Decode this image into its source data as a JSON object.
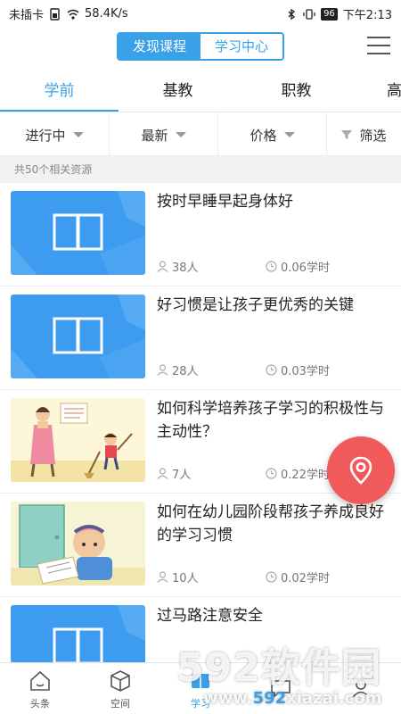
{
  "status_bar": {
    "carrier": "未插卡",
    "speed": "58.4K/s",
    "battery": "96",
    "time": "下午2:13"
  },
  "header": {
    "tabs": [
      {
        "label": "发现课程",
        "active": true
      },
      {
        "label": "学习中心",
        "active": false
      }
    ],
    "menu_icon": "hamburger-menu-icon"
  },
  "category_tabs": [
    {
      "label": "学前",
      "active": true
    },
    {
      "label": "基教",
      "active": false
    },
    {
      "label": "职教",
      "active": false
    },
    {
      "label": "高",
      "active": false
    }
  ],
  "filters": [
    {
      "label": "进行中",
      "icon": "caret-down-icon"
    },
    {
      "label": "最新",
      "icon": "caret-down-icon"
    },
    {
      "label": "价格",
      "icon": "caret-down-icon"
    },
    {
      "label": "筛选",
      "icon": "funnel-icon"
    }
  ],
  "result_count": "共50个相关资源",
  "courses": [
    {
      "title": "按时早睡早起身体好",
      "learners": "38人",
      "hours": "0.06学时",
      "thumb": "book-icon"
    },
    {
      "title": "好习惯是让孩子更优秀的关键",
      "learners": "28人",
      "hours": "0.03学时",
      "thumb": "book-icon"
    },
    {
      "title": "如何科学培养孩子学习的积极性与主动性？",
      "learners": "7人",
      "hours": "0.22学时",
      "thumb": "illustration-mother-child"
    },
    {
      "title": "如何在幼儿园阶段帮孩子养成良好的学习习惯",
      "learners": "10人",
      "hours": "0.02学时",
      "thumb": "illustration-child-studying"
    },
    {
      "title": "过马路注意安全",
      "learners": "",
      "hours": "",
      "thumb": "book-icon"
    }
  ],
  "bottom_nav": [
    {
      "label": "头条",
      "icon": "home-icon",
      "active": false
    },
    {
      "label": "空间",
      "icon": "cube-icon",
      "active": false
    },
    {
      "label": "学习",
      "icon": "book-icon",
      "active": true
    },
    {
      "label": "",
      "icon": "chat-icon",
      "active": false
    },
    {
      "label": "",
      "icon": "user-icon",
      "active": false
    }
  ],
  "watermark": {
    "brand": "592软件园",
    "url_prefix": "www.",
    "url_accent": "592",
    "url_suffix": "xiazai.com"
  },
  "colors": {
    "accent": "#3aa0e8",
    "fab": "#f05a5a",
    "thumb_blue": "#3d9cf0"
  }
}
